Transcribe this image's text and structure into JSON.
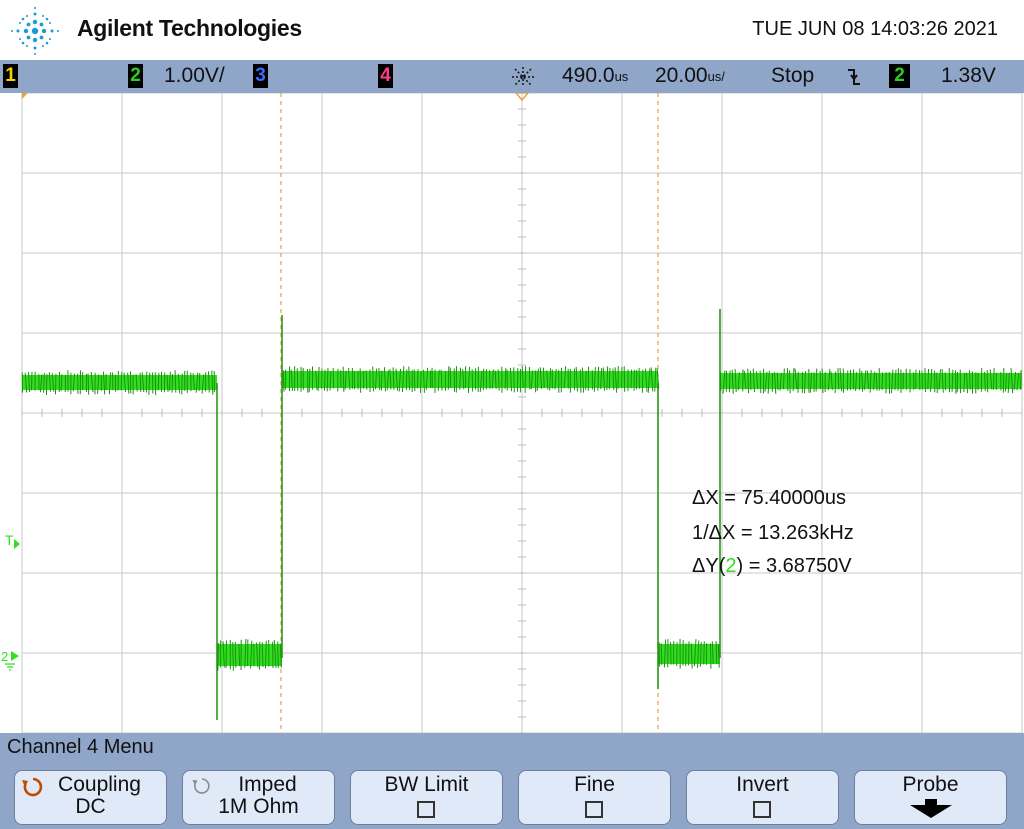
{
  "header": {
    "brand": "Agilent Technologies",
    "datetime": "TUE JUN 08 14:03:26 2021"
  },
  "statusbar": {
    "channels": [
      {
        "number": "1",
        "color": "#f5d000"
      },
      {
        "number": "2",
        "color": "#27d11e"
      },
      {
        "number": "3",
        "color": "#3b6cff"
      },
      {
        "number": "4",
        "color": "#ff3b8b"
      }
    ],
    "ch2_scale": "1.00V/",
    "delay_value": "490.0",
    "delay_unit": "us",
    "timebase_value": "20.00",
    "timebase_unit": "us/",
    "run_state": "Stop",
    "trigger_source": "2",
    "trigger_level": "1.38V"
  },
  "measurements": {
    "dx": "ΔX = 75.40000us",
    "inv_dx": "1/ΔX = 13.263kHz",
    "dy_prefix": "ΔY(",
    "dy_channel": "2",
    "dy_suffix": ") = 3.68750V"
  },
  "markers": {
    "trigger": "T",
    "ground": "2"
  },
  "menu": {
    "title": "Channel 4  Menu",
    "softkeys": [
      {
        "label": "Coupling",
        "value": "DC"
      },
      {
        "label": "Imped",
        "value": "1M Ohm"
      },
      {
        "label": "BW Limit",
        "value": ""
      },
      {
        "label": "Fine",
        "value": ""
      },
      {
        "label": "Invert",
        "value": ""
      },
      {
        "label": "Probe",
        "value": ""
      }
    ]
  },
  "colors": {
    "trace": "#2fe01f",
    "cursor": "#e6a440",
    "grid": "#c8c8c8",
    "bar": "#8fa6c9"
  }
}
